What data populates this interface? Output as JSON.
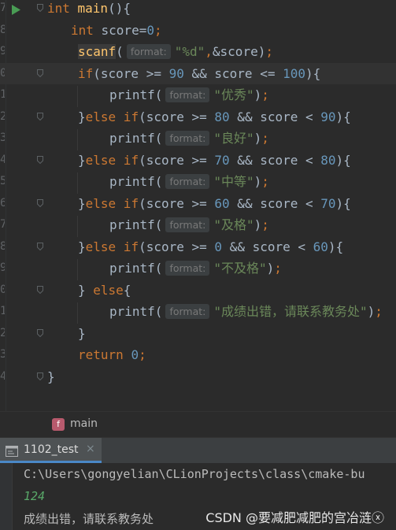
{
  "editor": {
    "line_numbers": [
      "7",
      "8",
      "9",
      "0",
      "1",
      "2",
      "3",
      "4",
      "5",
      "6",
      "7",
      "8",
      "9",
      "0",
      "1",
      "2",
      "3",
      "4"
    ],
    "hint_label": "format:",
    "lines": [
      {
        "t": [
          [
            "kw",
            "int "
          ],
          [
            "fn",
            "main"
          ],
          [
            "p",
            "(){"
          ]
        ]
      },
      {
        "t": [
          [
            "kw",
            "int "
          ],
          [
            "p",
            "score="
          ],
          [
            "num",
            "0"
          ],
          [
            "kw",
            ";"
          ]
        ]
      },
      {
        "t": [
          [
            "fnbg",
            "scanf"
          ],
          [
            "p",
            "("
          ],
          [
            "hint",
            ""
          ],
          [
            "str",
            "\"%d\""
          ],
          [
            "kw",
            ","
          ],
          [
            "p",
            "&score)"
          ],
          [
            "kw",
            ";"
          ]
        ]
      },
      {
        "t": [
          [
            "kw",
            "if"
          ],
          [
            "p",
            "(score >= "
          ],
          [
            "num",
            "90"
          ],
          [
            "p",
            " && score <= "
          ],
          [
            "num",
            "100"
          ],
          [
            "p",
            "){"
          ]
        ]
      },
      {
        "t": [
          [
            "p",
            "printf("
          ],
          [
            "hint",
            ""
          ],
          [
            "str",
            "\"优秀\""
          ],
          [
            "p",
            ")"
          ],
          [
            "kw",
            ";"
          ]
        ]
      },
      {
        "t": [
          [
            "p",
            "}"
          ],
          [
            "kw",
            "else if"
          ],
          [
            "p",
            "(score >= "
          ],
          [
            "num",
            "80"
          ],
          [
            "p",
            " && score < "
          ],
          [
            "num",
            "90"
          ],
          [
            "p",
            "){"
          ]
        ]
      },
      {
        "t": [
          [
            "p",
            "printf("
          ],
          [
            "hint",
            ""
          ],
          [
            "str",
            "\"良好\""
          ],
          [
            "p",
            ")"
          ],
          [
            "kw",
            ";"
          ]
        ]
      },
      {
        "t": [
          [
            "p",
            "}"
          ],
          [
            "kw",
            "else if"
          ],
          [
            "p",
            "(score >= "
          ],
          [
            "num",
            "70"
          ],
          [
            "p",
            " && score < "
          ],
          [
            "num",
            "80"
          ],
          [
            "p",
            "){"
          ]
        ]
      },
      {
        "t": [
          [
            "p",
            "printf("
          ],
          [
            "hint",
            ""
          ],
          [
            "str",
            "\"中等\""
          ],
          [
            "p",
            ")"
          ],
          [
            "kw",
            ";"
          ]
        ]
      },
      {
        "t": [
          [
            "p",
            "}"
          ],
          [
            "kw",
            "else if"
          ],
          [
            "p",
            "(score >= "
          ],
          [
            "num",
            "60"
          ],
          [
            "p",
            " && score < "
          ],
          [
            "num",
            "70"
          ],
          [
            "p",
            "){"
          ]
        ]
      },
      {
        "t": [
          [
            "p",
            "printf("
          ],
          [
            "hint",
            ""
          ],
          [
            "str",
            "\"及格\""
          ],
          [
            "p",
            ")"
          ],
          [
            "kw",
            ";"
          ]
        ]
      },
      {
        "t": [
          [
            "p",
            "}"
          ],
          [
            "kw",
            "else if"
          ],
          [
            "p",
            "(score >= "
          ],
          [
            "num",
            "0"
          ],
          [
            "p",
            " && score < "
          ],
          [
            "num",
            "60"
          ],
          [
            "p",
            "){"
          ]
        ]
      },
      {
        "t": [
          [
            "p",
            "printf("
          ],
          [
            "hint",
            ""
          ],
          [
            "str",
            "\"不及格\""
          ],
          [
            "p",
            ")"
          ],
          [
            "kw",
            ";"
          ]
        ]
      },
      {
        "t": [
          [
            "p",
            "} "
          ],
          [
            "kw",
            "else"
          ],
          [
            "p",
            "{"
          ]
        ]
      },
      {
        "t": [
          [
            "p",
            "printf("
          ],
          [
            "hint",
            ""
          ],
          [
            "str",
            "\"成绩出错，请联系教务处\""
          ],
          [
            "p",
            ")"
          ],
          [
            "kw",
            ";"
          ]
        ]
      },
      {
        "t": [
          [
            "p",
            "}"
          ]
        ]
      },
      {
        "t": [
          [
            "kw",
            "return "
          ],
          [
            "num",
            "0"
          ],
          [
            "kw",
            ";"
          ]
        ]
      },
      {
        "t": [
          [
            "p",
            "}"
          ]
        ]
      }
    ]
  },
  "breadcrumb": {
    "badge": "f",
    "label": "main"
  },
  "run_tab": {
    "label": "1102_test",
    "close": "×"
  },
  "console": {
    "path": "C:\\Users\\gongyelian\\CLionProjects\\class\\cmake-bu",
    "input": "124",
    "output": "成绩出错，请联系教务处"
  },
  "watermark": "CSDN @要减肥减肥的宫冶涟ⓧ",
  "colors": {
    "keyword": "#cc7832",
    "number": "#6897bb",
    "string": "#6a8759",
    "function": "#ffc66d",
    "text": "#a9b7c6",
    "input": "#59a869",
    "run_icon": "#499c54"
  }
}
